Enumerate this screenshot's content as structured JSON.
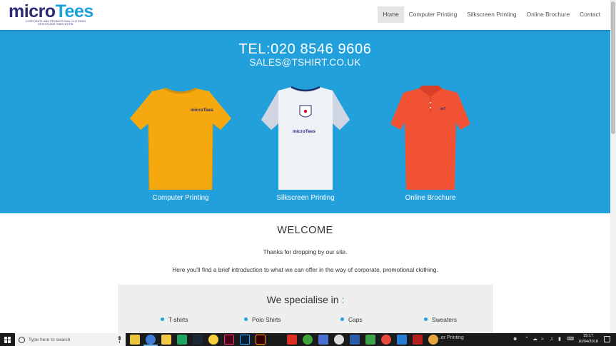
{
  "header": {
    "logo": {
      "word_a": "micro",
      "word_b": "Tees",
      "tagline": "CORPORATE AND PROMOTIONAL CLOTHING DESIGN AND INNOVATION"
    },
    "nav": [
      {
        "label": "Home",
        "active": true
      },
      {
        "label": "Computer Printing",
        "active": false
      },
      {
        "label": "Silkscreen Printing",
        "active": false
      },
      {
        "label": "Online Brochure",
        "active": false
      },
      {
        "label": "Contact",
        "active": false
      }
    ]
  },
  "hero": {
    "tel": "TEL:020 8546 9606",
    "email": "SALES@TSHIRT.CO.UK",
    "background": "#22a0dc",
    "products": [
      {
        "label": "Computer Printing",
        "shirt_color": "#f5a90f",
        "brand": "microTees"
      },
      {
        "label": "Silkscreen Printing",
        "shirt_color": "#e9edf3",
        "brand": "microTees"
      },
      {
        "label": "Online Brochure",
        "shirt_color": "#f25234",
        "brand": "mT"
      }
    ]
  },
  "welcome": {
    "title": "WELCOME",
    "p1": "Thanks for dropping by our site.",
    "p2": "Here you'll find a brief introduction to what we can offer in the way of corporate, promotional clothing."
  },
  "specialise": {
    "title": "We specialise in",
    "colon": ":",
    "items": [
      "T-shirts",
      "Polo Shirts",
      "Caps",
      "Sweaters"
    ]
  },
  "taskbar": {
    "search_placeholder": "Type here to search",
    "caption": "...er Printing",
    "time": "15:17",
    "date": "10/04/2018",
    "apps": [
      "file-explorer-icon",
      "chrome-icon",
      "folder-icon",
      "drive-icon",
      "steam-icon",
      "sticky-icon",
      "indesign-icon",
      "photoshop-icon",
      "illustrator-icon",
      "mail-icon",
      "edge-icon",
      "music-icon",
      "notes-icon",
      "chrome-alt-icon",
      "powershell-icon",
      "network-icon",
      "chrome-2-icon",
      "doc-icon",
      "filezilla-icon",
      "chrome-3-icon"
    ]
  }
}
